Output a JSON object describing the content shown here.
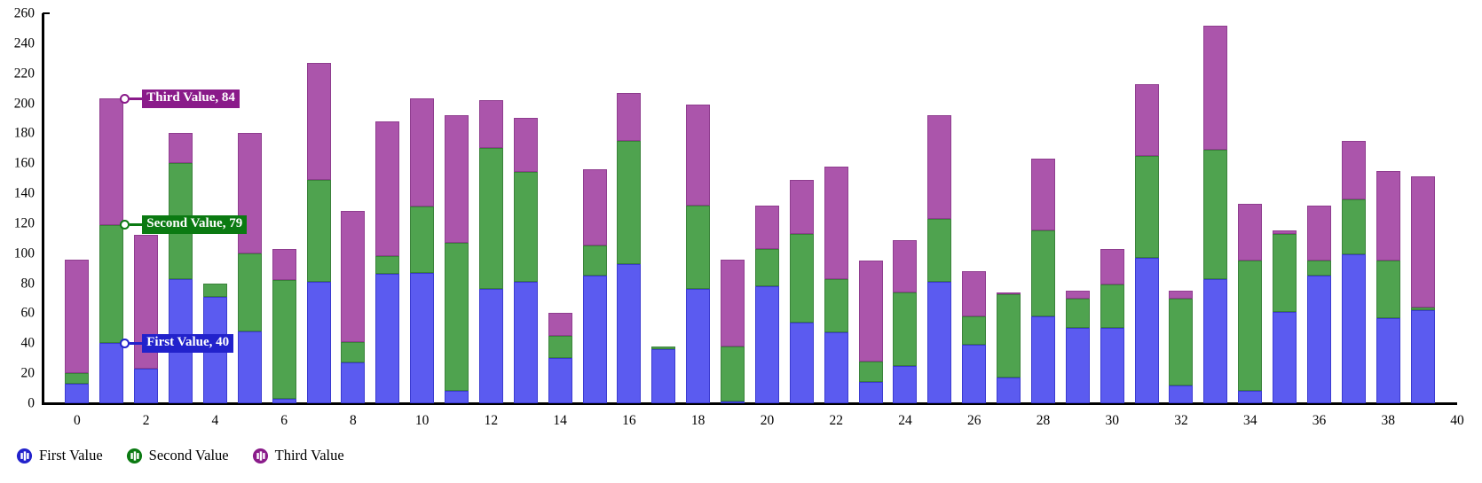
{
  "chart_data": {
    "type": "bar",
    "stacked": true,
    "title": "",
    "xlabel": "",
    "ylabel": "",
    "xlim": [
      -1,
      40
    ],
    "ylim": [
      0,
      260
    ],
    "ytick_step": 20,
    "xtick_step": 2,
    "grid": false,
    "legend_position": "bottom-left",
    "x": [
      0,
      1,
      2,
      3,
      4,
      5,
      6,
      7,
      8,
      9,
      10,
      11,
      12,
      13,
      14,
      15,
      16,
      17,
      18,
      19,
      20,
      21,
      22,
      23,
      24,
      25,
      26,
      27,
      28,
      29,
      30,
      31,
      32,
      33,
      34,
      35,
      36,
      37,
      38,
      39
    ],
    "yticks": [
      0,
      20,
      40,
      60,
      80,
      100,
      120,
      140,
      160,
      180,
      200,
      220,
      240,
      260
    ],
    "xticks": [
      0,
      2,
      4,
      6,
      8,
      10,
      12,
      14,
      16,
      18,
      20,
      22,
      24,
      26,
      28,
      30,
      32,
      34,
      36,
      38,
      40
    ],
    "series": [
      {
        "name": "First Value",
        "color": "#5b5bf0",
        "values": [
          13,
          40,
          23,
          83,
          71,
          48,
          3,
          81,
          27,
          86,
          87,
          8,
          76,
          81,
          30,
          85,
          93,
          36,
          76,
          1,
          78,
          54,
          47,
          14,
          25,
          81,
          39,
          17,
          58,
          50,
          50,
          97,
          12,
          83,
          8,
          61,
          85,
          99,
          57,
          62
        ]
      },
      {
        "name": "Second Value",
        "color": "#4fa34f",
        "values": [
          7,
          79,
          0,
          77,
          9,
          52,
          79,
          68,
          14,
          12,
          44,
          99,
          94,
          73,
          15,
          20,
          82,
          2,
          56,
          37,
          25,
          59,
          36,
          14,
          49,
          42,
          19,
          56,
          57,
          20,
          29,
          68,
          58,
          86,
          87,
          52,
          10,
          37,
          38,
          2
        ]
      },
      {
        "name": "Third Value",
        "color": "#ab55ab",
        "values": [
          76,
          84,
          89,
          20,
          0,
          80,
          21,
          78,
          87,
          90,
          72,
          85,
          32,
          36,
          15,
          51,
          32,
          0,
          67,
          58,
          29,
          36,
          75,
          67,
          35,
          69,
          30,
          1,
          48,
          5,
          24,
          48,
          5,
          83,
          38,
          2,
          37,
          39,
          60,
          87
        ]
      }
    ],
    "totals": [
      96,
      203,
      112,
      180,
      80,
      180,
      103,
      227,
      128,
      188,
      203,
      192,
      202,
      190,
      60,
      156,
      207,
      38,
      199,
      96,
      132,
      149,
      158,
      95,
      109,
      192,
      88,
      74,
      163,
      75,
      103,
      213,
      75,
      252,
      133,
      115,
      132,
      175,
      155,
      151
    ],
    "annotations": [
      {
        "id": "third",
        "series": "Third Value",
        "label": "Third Value, 84",
        "value": 84,
        "x_index": 1,
        "y": 203,
        "color": "#8a1b8a"
      },
      {
        "id": "second",
        "series": "Second Value",
        "label": "Second Value, 79",
        "value": 79,
        "x_index": 1,
        "y": 119,
        "color": "#0b7a12"
      },
      {
        "id": "first",
        "series": "First Value",
        "label": "First Value, 40",
        "value": 40,
        "x_index": 1,
        "y": 40,
        "color": "#2222cc"
      }
    ]
  },
  "legend": {
    "items": [
      {
        "label": "First Value",
        "color": "#2222cc",
        "icon": "bar-chart-circle-icon"
      },
      {
        "label": "Second Value",
        "color": "#0b7a12",
        "icon": "bar-chart-circle-icon"
      },
      {
        "label": "Third Value",
        "color": "#8a1b8a",
        "icon": "bar-chart-circle-icon"
      }
    ]
  }
}
